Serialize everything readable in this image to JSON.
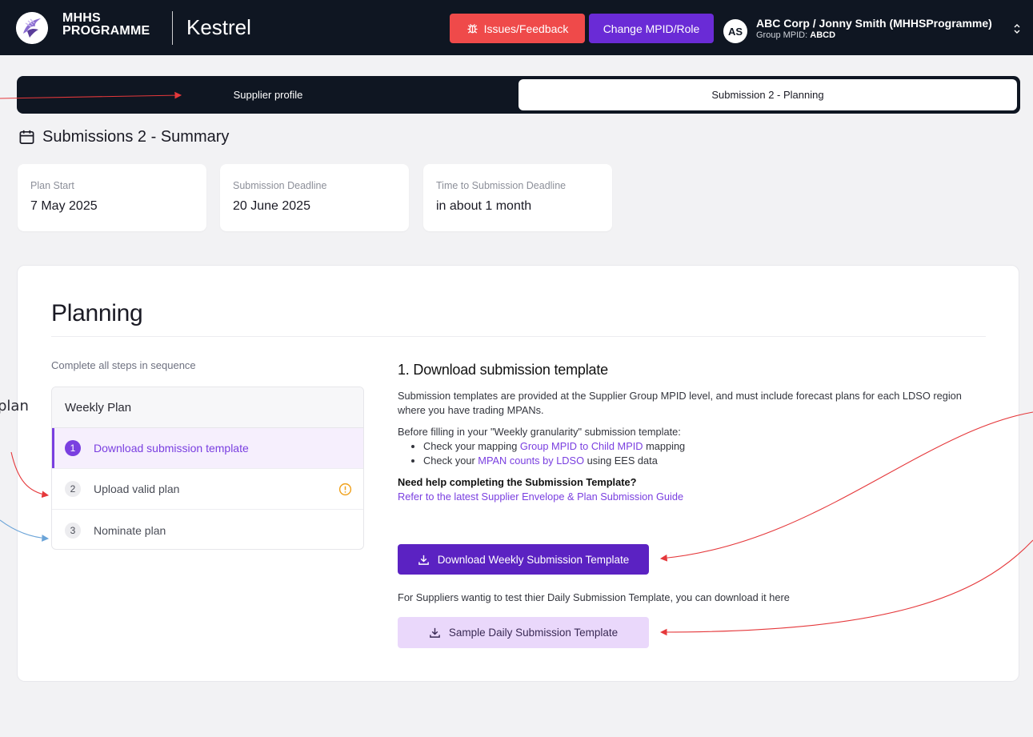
{
  "header": {
    "logo_line1": "MHHS",
    "logo_line2": "PROGRAMME",
    "app_name": "Kestrel",
    "issues_label": "Issues/Feedback",
    "change_label": "Change MPID/Role",
    "avatar_initials": "AS",
    "account_name": "ABC Corp  /  Jonny Smith (MHHSProgramme)",
    "group_mpid_label": "Group MPID:",
    "group_mpid_value": "ABCD"
  },
  "tabs": [
    {
      "label": "Supplier profile",
      "active": false
    },
    {
      "label": "Submission 2 - Planning",
      "active": true
    }
  ],
  "summary": {
    "title": "Submissions 2 - Summary",
    "cards": [
      {
        "label": "Plan Start",
        "value": "7 May 2025"
      },
      {
        "label": "Submission Deadline",
        "value": "20 June 2025"
      },
      {
        "label": "Time to Submission Deadline",
        "value": "in about 1 month"
      }
    ]
  },
  "planning": {
    "title": "Planning",
    "hint": "Complete all steps in sequence",
    "steps_header": "Weekly Plan",
    "steps": [
      {
        "num": "1",
        "label": "Download submission template",
        "active": true
      },
      {
        "num": "2",
        "label": "Upload valid plan",
        "warning": true
      },
      {
        "num": "3",
        "label": "Nominate plan"
      }
    ],
    "content": {
      "heading": "1. Download submission template",
      "intro": "Submission templates are provided at the Supplier Group MPID level, and must include forecast plans for each LDSO region where you have trading MPANs.",
      "before": "Before filling in your \"Weekly granularity\" submission template:",
      "bullet1_pre": "Check your mapping ",
      "bullet1_link": "Group MPID to Child MPID",
      "bullet1_post": " mapping",
      "bullet2_pre": "Check your ",
      "bullet2_link": "MPAN counts by LDSO",
      "bullet2_post": " using EES data",
      "help_question": "Need help completing the Submission Template?",
      "help_link": "Refer to the latest Supplier Envelope & Plan Submission Guide",
      "download_button": "Download Weekly Submission Template",
      "daily_note": "For Suppliers wantig to test thier Daily Submission Template, you can download it here",
      "sample_button": "Sample Daily Submission Template"
    }
  },
  "annotation": {
    "edge_text": "plan"
  },
  "colors": {
    "header_bg": "#0f1622",
    "issues_red": "#ef4a4a",
    "purple": "#6a2bd6",
    "link_purple": "#7a3fe0",
    "download_purple": "#5b22c2",
    "sample_lilac": "#ead8fb",
    "annotation_red": "#e5383b",
    "annotation_blue": "#6ba4d8"
  }
}
